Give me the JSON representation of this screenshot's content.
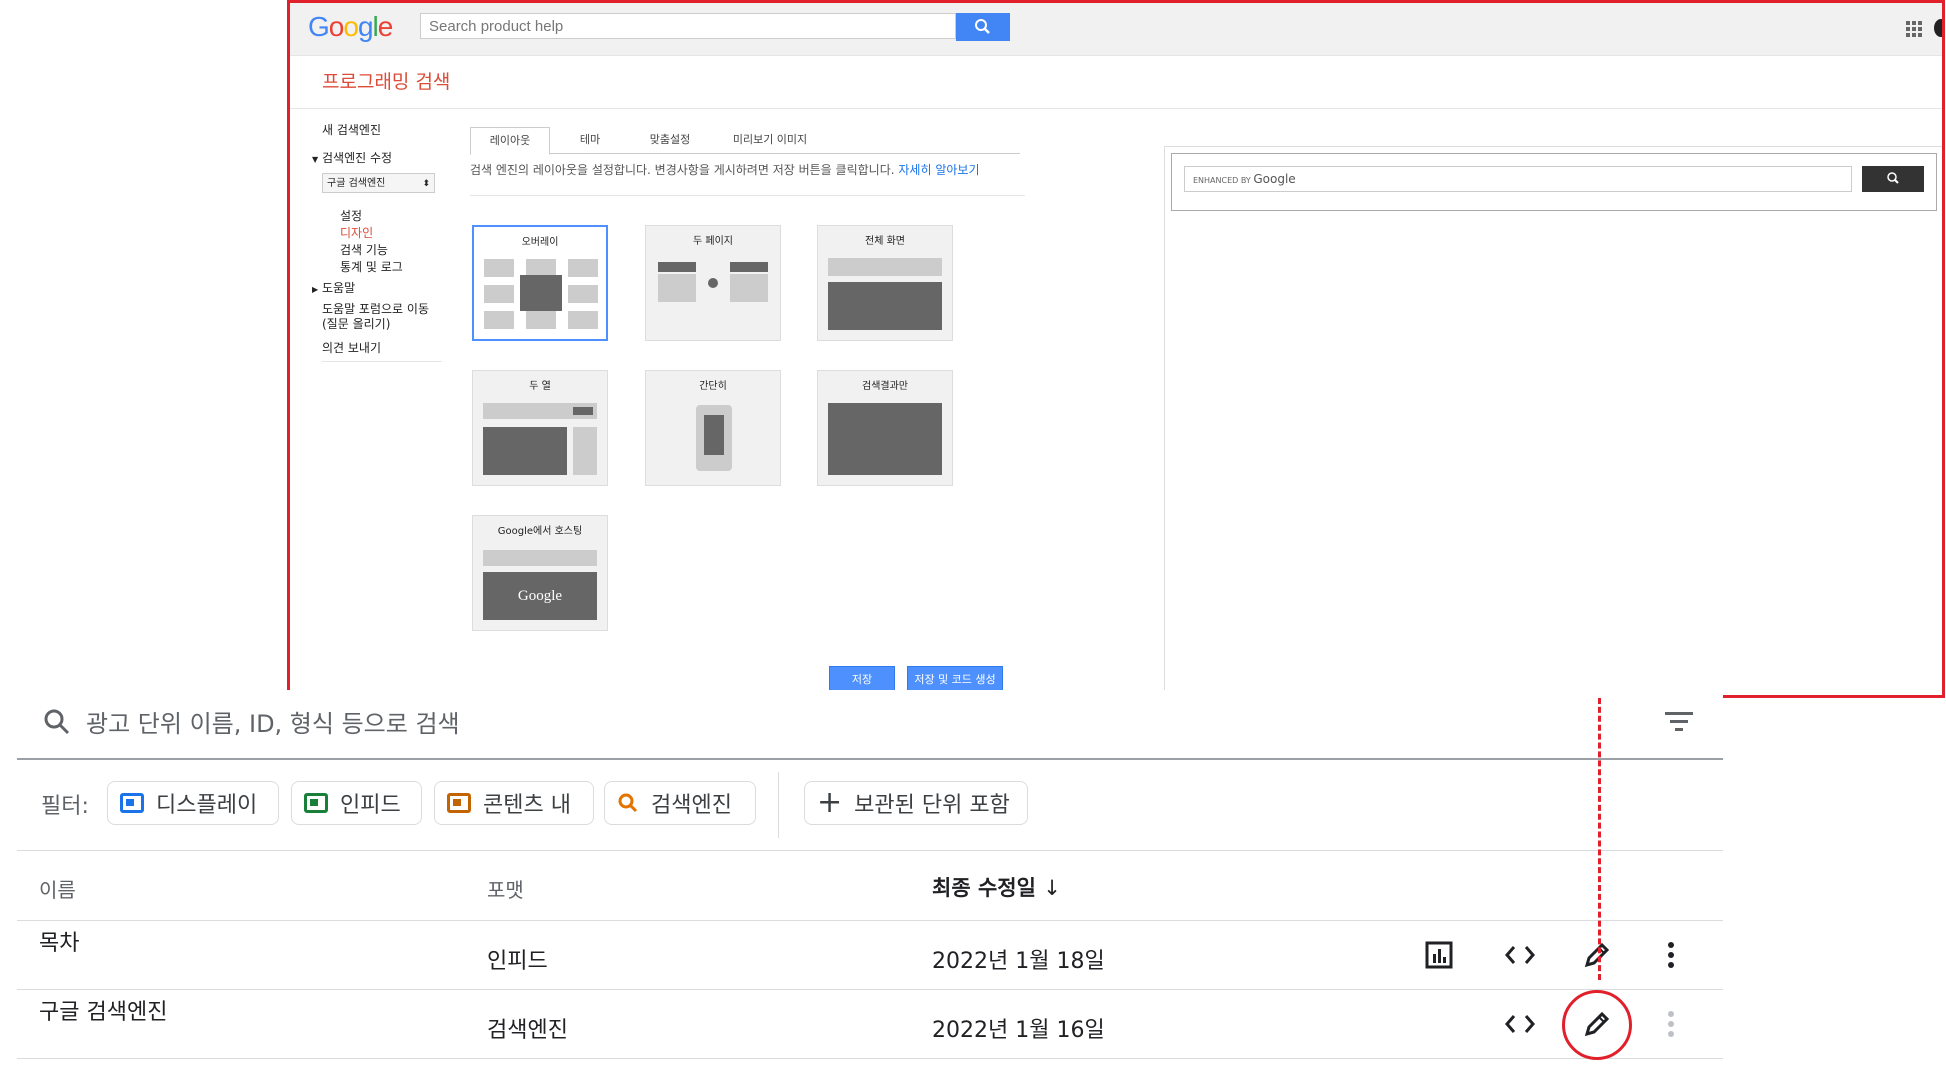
{
  "overlay": {
    "google_logo": "Google",
    "search_placeholder": "Search product help",
    "page_title": "프로그래밍 검색",
    "nav": {
      "new_engine": "새 검색엔진",
      "edit_engine": "검색엔진 수정",
      "selected_engine": "구글 검색엔진",
      "settings": "설정",
      "design": "디자인",
      "search_features": "검색 기능",
      "stats_logs": "통계 및 로그",
      "help": "도움말",
      "help_forum_1": "도움말 포럼으로 이동",
      "help_forum_2": "(질문 올리기)",
      "feedback": "의견 보내기"
    },
    "tabs": [
      "레이아웃",
      "테마",
      "맞춤설정",
      "미리보기 이미지"
    ],
    "description": "검색 엔진의 레이아웃을 설정합니다. 변경사항을 게시하려면 저장 버튼을 클릭합니다.",
    "learn_more": "자세히 알아보기",
    "layouts": [
      "오버레이",
      "두 페이지",
      "전체 화면",
      "두 열",
      "간단히",
      "검색결과만",
      "Google에서 호스팅"
    ],
    "hosted_logo": "Google",
    "save_label": "저장",
    "save_code_label": "저장 및 코드 생성",
    "enhanced_by": "ENHANCED BY",
    "enhanced_google": "Google"
  },
  "list": {
    "search_placeholder": "광고 단위 이름, ID, 형식 등으로 검색",
    "filter_label": "필터:",
    "chips": [
      {
        "label": "디스플레이",
        "color": "#1a73e8"
      },
      {
        "label": "인피드",
        "color": "#188038"
      },
      {
        "label": "콘텐츠 내",
        "color": "#c26401"
      },
      {
        "label": "검색엔진",
        "color": "#e37400"
      }
    ],
    "archived_label": "보관된 단위 포함",
    "columns": {
      "name": "이름",
      "format": "포맷",
      "modified": "최종 수정일"
    },
    "rows": [
      {
        "name": "목차",
        "format": "인피드",
        "modified": "2022년 1월 18일"
      },
      {
        "name": "구글 검색엔진",
        "format": "검색엔진",
        "modified": "2022년 1월 16일"
      }
    ]
  },
  "colors": {
    "highlight": "#e0202a",
    "accent": "#4285f4",
    "title_red": "#dd4b39"
  }
}
